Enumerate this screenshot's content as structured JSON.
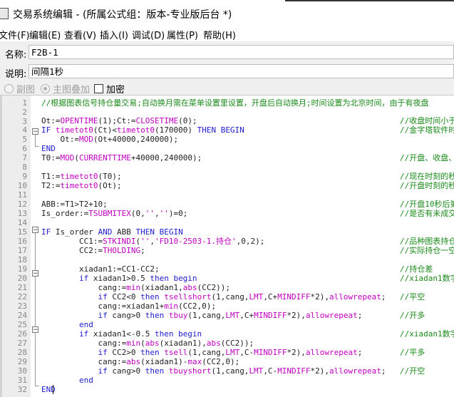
{
  "window": {
    "title": "交易系统编辑 - (所属公式组：版本-专业版后台 *)"
  },
  "menu": [
    "文件(F)",
    "编辑(E)",
    "查看(V)",
    "插入(I)",
    "调试(D)",
    "属性(P)",
    "帮助(H)"
  ],
  "form": {
    "name_label": "名称:",
    "name_value": "F2B-1",
    "desc_label": "说明:",
    "desc_value": "间隔1秒"
  },
  "options": {
    "sub_chart": "副图",
    "main_overlay": "主图叠加",
    "encrypt": "加密"
  },
  "editor": {
    "line_numbers": [
      "1",
      "2",
      "3",
      "4",
      "5",
      "6",
      "7",
      "8",
      "9",
      "10",
      "11",
      "12",
      "13",
      "14",
      "15",
      "16",
      "17",
      "18",
      "19",
      "20",
      "21",
      "22",
      "23",
      "24",
      "25",
      "26",
      "27",
      "28",
      "29",
      "30",
      "31",
      "32"
    ],
    "comments": [
      "//根据图表信号持仓量交易;自动换月需在菜单设置里设置，开盘后自动换月;时间设置为北京时间，由于有夜盘",
      "//收盘时间小于",
      "//金字塔软件时",
      "//开盘、收盘、",
      "//现在时刻的秒",
      "//开盘时刻的秒",
      "//开盘10秒后第",
      "//是否有未成交",
      "//品种图表持仓",
      "//实际持仓一空",
      "//持仓差",
      "//xiadan1数字",
      "//平空",
      "//开多",
      "//xiadan1数字",
      "//平多",
      "//开空"
    ]
  }
}
